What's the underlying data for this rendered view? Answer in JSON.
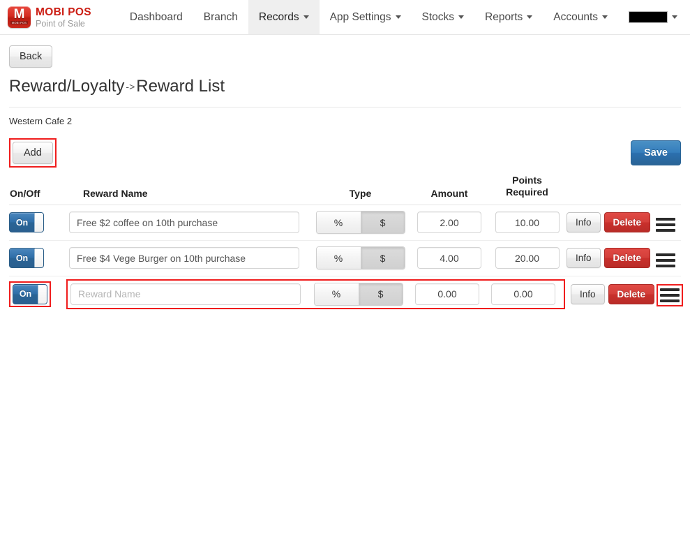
{
  "brand": {
    "logo_letter": "M",
    "logo_sub": "MOBI POS",
    "title": "MOBI POS",
    "subtitle": "Point of Sale"
  },
  "nav": {
    "items": [
      {
        "label": "Dashboard",
        "caret": false,
        "active": false,
        "redacted": false
      },
      {
        "label": "Branch",
        "caret": false,
        "active": false,
        "redacted": false
      },
      {
        "label": "Records",
        "caret": true,
        "active": true,
        "redacted": false
      },
      {
        "label": "App Settings",
        "caret": true,
        "active": false,
        "redacted": false
      },
      {
        "label": "Stocks",
        "caret": true,
        "active": false,
        "redacted": false
      },
      {
        "label": "Reports",
        "caret": true,
        "active": false,
        "redacted": false
      },
      {
        "label": "Accounts",
        "caret": true,
        "active": false,
        "redacted": false
      },
      {
        "label": "",
        "caret": true,
        "active": false,
        "redacted": true
      }
    ]
  },
  "page": {
    "back_label": "Back",
    "title_primary": "Reward/Loyalty",
    "title_arrow": "->",
    "title_secondary": "Reward List",
    "branch_name": "Western Cafe 2"
  },
  "toolbar": {
    "add_label": "Add",
    "save_label": "Save"
  },
  "table": {
    "headers": {
      "onoff": "On/Off",
      "name": "Reward Name",
      "type": "Type",
      "amount": "Amount",
      "points_line1": "Points",
      "points_line2": "Required"
    },
    "type_options": {
      "percent": "%",
      "dollar": "$"
    },
    "info_label": "Info",
    "delete_label": "Delete",
    "name_placeholder": "Reward Name",
    "rows": [
      {
        "toggle_label": "On",
        "toggle_on": true,
        "name": "Free $2 coffee on 10th purchase",
        "name_is_placeholder": false,
        "type_selected": "$",
        "amount": "2.00",
        "points": "10.00",
        "highlighted": false
      },
      {
        "toggle_label": "On",
        "toggle_on": true,
        "name": "Free $4 Vege Burger on 10th purchase",
        "name_is_placeholder": false,
        "type_selected": "$",
        "amount": "4.00",
        "points": "20.00",
        "highlighted": false
      },
      {
        "toggle_label": "On",
        "toggle_on": true,
        "name": "",
        "name_is_placeholder": true,
        "type_selected": "$",
        "amount": "0.00",
        "points": "0.00",
        "highlighted": true
      }
    ]
  },
  "colors": {
    "brand_red": "#cc1f15",
    "primary_blue": "#2a6496",
    "danger_red": "#c9302c",
    "annotation_red": "#f01d1d",
    "nav_active_bg": "#efefef"
  }
}
